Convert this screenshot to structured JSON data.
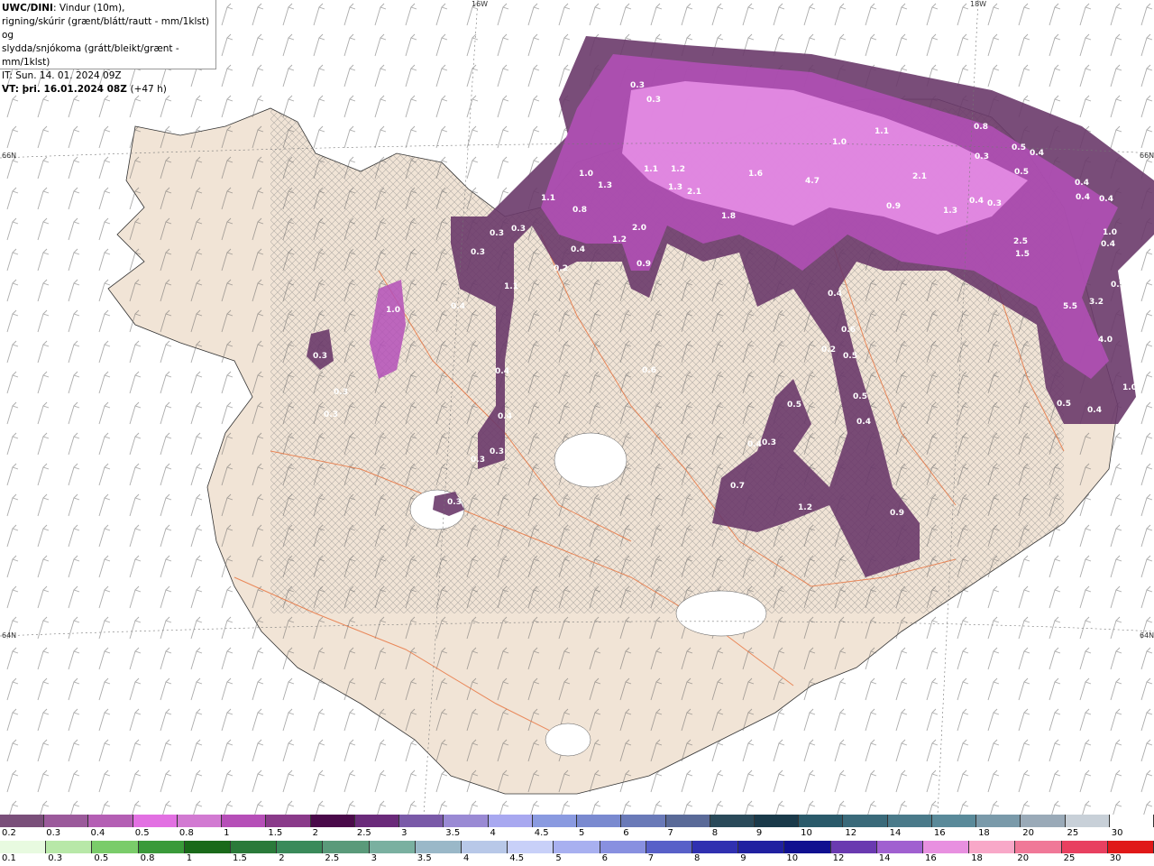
{
  "header": {
    "title_bold": "UWC/DINI",
    "title_rest": ": Vindur (10m),",
    "line2": "rigning/skúrir (grænt/blátt/rautt - mm/1klst) og",
    "line3": "slydda/snjókoma (grátt/bleikt/grænt - mm/1klst)",
    "it": "IT: Sun. 14. 01. 2024 09Z",
    "vt_label": "VT:",
    "vt_value": "þri. 16.01.2024 08Z",
    "vt_offset": "(+47 h)"
  },
  "axis_labels": [
    "66N",
    "64N",
    "16W",
    "18W",
    "66N",
    "64N"
  ],
  "precip_labels": [
    "0.3",
    "0.3",
    "1.0",
    "1.1",
    "1.2",
    "1.6",
    "4.7",
    "2.1",
    "1.0",
    "1.1",
    "1.3",
    "2.1",
    "0.5",
    "0.4",
    "0.5",
    "1.0",
    "1.3",
    "1.1",
    "0.8",
    "1.2",
    "2.0",
    "0.9",
    "0.3",
    "0.3",
    "0.4",
    "0.3",
    "1.1",
    "1.8",
    "0.9",
    "1.3",
    "0.4",
    "0.4",
    "0.4",
    "0.4",
    "2.5",
    "1.5",
    "5.5",
    "3.2",
    "4.0",
    "0.4",
    "1.0",
    "0.5",
    "0.4",
    "1.0",
    "0.4",
    "0.3",
    "0.3",
    "0.3",
    "0.6",
    "0.4",
    "0.3",
    "0.3",
    "0.3",
    "0.3",
    "0.5",
    "0.5",
    "0.4",
    "0.4",
    "0.3",
    "0.7",
    "1.2",
    "0.9",
    "0.3",
    "0.2",
    "0.5",
    "0.4",
    "0.8",
    "0.6",
    "0.2",
    "0.4",
    "0.5"
  ],
  "legend_snow": {
    "labels": [
      "0.2",
      "0.3",
      "0.4",
      "0.5",
      "0.8",
      "1",
      "1.5",
      "2",
      "2.5",
      "3",
      "3.5",
      "4",
      "4.5",
      "5",
      "6",
      "7",
      "8",
      "9",
      "10",
      "12",
      "14",
      "16",
      "18",
      "20",
      "25",
      "30"
    ],
    "colors": [
      "#7a4f7a",
      "#9b5a9b",
      "#b45fb4",
      "#e270e2",
      "#d27ad2",
      "#b64fb8",
      "#8a3a8a",
      "#4a0a4a",
      "#6a2a7a",
      "#7a5aa8",
      "#9a8ad4",
      "#a8a8f0",
      "#8a9ae0",
      "#7a8ad0",
      "#6a7ab8",
      "#5a6a98",
      "#2a4a5a",
      "#1a3a4a",
      "#2a5a6a",
      "#3a6a7a",
      "#4a7a8a",
      "#5a8a9a",
      "#7a9aaa",
      "#9aaab8",
      "#c8d0d8",
      "#ffffff"
    ]
  },
  "legend_rain": {
    "labels": [
      "0.1",
      "0.3",
      "0.5",
      "0.8",
      "1",
      "1.5",
      "2",
      "2.5",
      "3",
      "3.5",
      "4",
      "4.5",
      "5",
      "6",
      "7",
      "8",
      "9",
      "10",
      "12",
      "14",
      "16",
      "18",
      "20",
      "25",
      "30"
    ],
    "colors": [
      "#e8fae0",
      "#b8e8a8",
      "#7acc6a",
      "#3a9a3a",
      "#1a6a1a",
      "#2a7a3a",
      "#3a8a5a",
      "#5a9a7a",
      "#7ab0a0",
      "#9ab8c8",
      "#b8c8e8",
      "#c8d0f8",
      "#a8b0f0",
      "#8890e0",
      "#5860c8",
      "#3030b0",
      "#2020a0",
      "#101090",
      "#6a3ab0",
      "#a060d0",
      "#e890e0",
      "#f8a8c8",
      "#f07898",
      "#e84060",
      "#e01818"
    ]
  },
  "colors": {
    "land": "#f1e4d6",
    "sea": "#ffffff",
    "roads": "#e8703a",
    "precip_light": "#d98ad9",
    "precip_mid": "#b450b8",
    "precip_dark": "#6a3a6a",
    "hatch": "#888888"
  }
}
